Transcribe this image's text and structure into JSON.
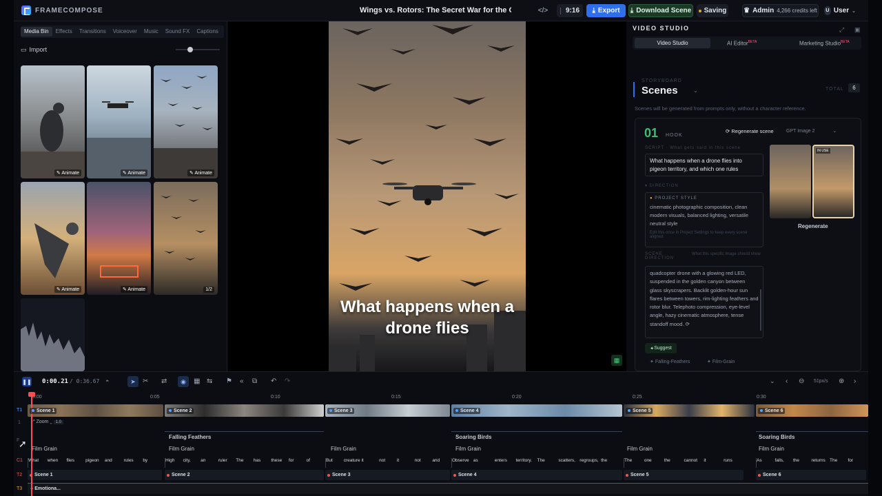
{
  "app": {
    "name": "FRAMECOMPOSE",
    "project_title": "Wings vs. Rotors: The Secret War for the Ci..."
  },
  "topbar": {
    "ratio": "9:16",
    "export": "Export",
    "download": "Download Scene",
    "saving": "Saving",
    "admin": "Admin",
    "credits": "4,266 credits left",
    "user": "User",
    "user_initial": "U"
  },
  "media": {
    "tabs": [
      "Media Bin",
      "Effects",
      "Transitions",
      "Voiceover",
      "Music",
      "Sound FX",
      "Captions"
    ],
    "import": "Import",
    "animate": "Animate",
    "badge": "1/2"
  },
  "preview": {
    "subtitle": "What happens when a drone flies"
  },
  "studio": {
    "title": "VIDEO STUDIO",
    "tabs": [
      {
        "label": "Video Studio"
      },
      {
        "label": "AI Editor",
        "badge": "BETA"
      },
      {
        "label": "Marketing Studio",
        "badge": "BETA"
      }
    ],
    "storyboard": "STORYBOARD",
    "scenes": "Scenes",
    "total_label": "TOTAL",
    "total": "6",
    "note": "Scenes will be generated from prompts only, without a character reference.",
    "scene": {
      "number": "01",
      "kind": "HOOK",
      "regenerate_scene": "Regenerate scene",
      "model": "GPT Image 2",
      "script_label": "SCRIPT",
      "script_hint": "What gets said in this scene",
      "script": "What happens when a drone flies into pigeon territory, and which one rules",
      "direction": "DIRECTION",
      "project_style_label": "PROJECT STYLE",
      "project_style": "cinematic photographic composition, clean modern visuals, balanced lighting, versatile neutral style",
      "style_hint": "Edit this once in Project Settings to keep every scene aligned.",
      "scene_direction_label": "SCENE DIRECTION",
      "scene_direction_hint": "What this specific image should show",
      "scene_direction": "quadcopter drone with a glowing red LED, suspended in the golden canyon between glass skyscrapers. Backlit golden-hour sun flares between towers, rim-lighting feathers and rotor blur. Telephoto compression, eye-level angle, hazy cinematic atmosphere, tense standoff mood.",
      "in_use": "IN USE",
      "regenerate": "Regenerate",
      "suggest": "Suggest",
      "chips": [
        "Falling-Feathers",
        "Film-Grain"
      ]
    }
  },
  "timeline": {
    "current": "0:00.21",
    "total": "/ 0:36.67",
    "zoom": "51px/s",
    "ruler": [
      "0:00",
      "0:05",
      "0:10",
      "0:15",
      "0:20",
      "0:25",
      "0:30"
    ],
    "track_labels": [
      "T1",
      "1",
      "F",
      "C1",
      "T2",
      "T3"
    ],
    "zoom_row": {
      "label": "Zoom",
      "value": "1.0"
    },
    "scenes": [
      "Scene 1",
      "Scene 2",
      "Scene 3",
      "Scene 4",
      "Scene 5",
      "Scene 6"
    ],
    "transitions": [
      "Falling Feathers",
      "Soaring Birds",
      "Soaring Birds"
    ],
    "effects": [
      "Film Grain",
      "Film Grain",
      "Film Grain",
      "Film Grain",
      "Film Grain",
      "Film Grain"
    ],
    "captions": [
      [
        "What",
        "when",
        "flies",
        "pigeon",
        "and",
        "rules",
        "by"
      ],
      [
        "High",
        "city,",
        "an",
        "ruler",
        "The",
        "has",
        "these",
        "for",
        "of"
      ],
      [
        "But",
        "creature",
        "it",
        "not",
        "it",
        "not",
        "and"
      ],
      [
        "Observe",
        "as",
        "enters",
        "territory.",
        "The",
        "scatters,",
        "regroups,",
        "the"
      ],
      [
        "The",
        "one",
        "the",
        "cannot",
        "it",
        "runs"
      ],
      [
        "As",
        "falls,",
        "the",
        "returns",
        "The",
        "for"
      ]
    ],
    "music": "Emotiona..."
  },
  "colors": {
    "accent": "#2f6fed",
    "download": "#1f6a3c",
    "saving": "#e0a63a",
    "playhead": "#ff4d4d"
  }
}
